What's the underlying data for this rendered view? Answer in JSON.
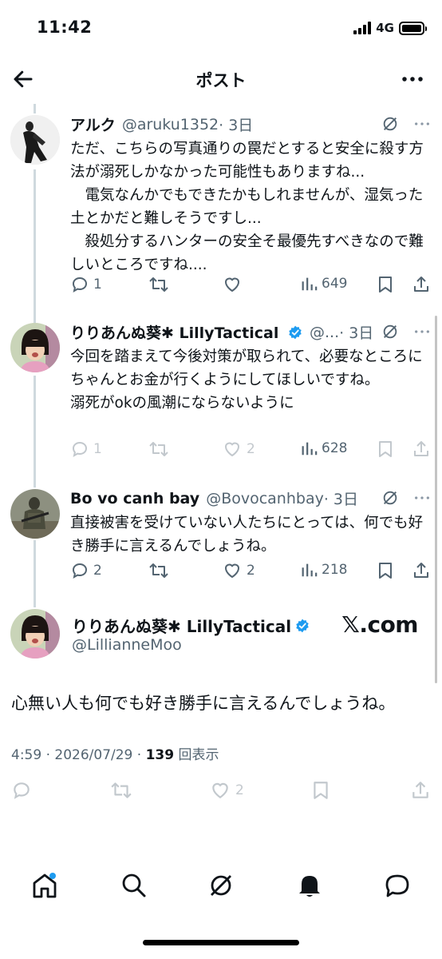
{
  "status_bar": {
    "time": "11:42",
    "network": "4G"
  },
  "header": {
    "title": "ポスト"
  },
  "replies": [
    {
      "name": "アルク",
      "handle": "@aruku1352",
      "time": "· 3日",
      "verified": false,
      "text": "ただ、こちらの写真通りの罠だとすると安全に殺す方法が溺死しかなかった可能性もありますね...\n　電気なんかでもできたかもしれませんが、湿気った土とかだと難しそうですし...\n　殺処分するハンターの安全そ最優先すべきなので難しいところですね....",
      "replies_count": "1",
      "retweets_count": "",
      "likes_count": "",
      "views_count": "649"
    },
    {
      "name": "りりあんぬ葵✱ LillyTactical",
      "handle": "@...",
      "time": "· 3日",
      "verified": true,
      "text": "今回を踏まえて今後対策が取られて、必要なところにちゃんとお金が行くようにしてほしいですね。\n溺死がokの風潮にならないように",
      "replies_count": "1",
      "retweets_count": "",
      "likes_count": "2",
      "views_count": "628"
    },
    {
      "name": "Bo vo canh bay",
      "handle": "@Bovocanhbay",
      "time": "· 3日",
      "verified": false,
      "text": "直接被害を受けていない人たちにとっては、何でも好き勝手に言えるんでしょうね。",
      "replies_count": "2",
      "retweets_count": "",
      "likes_count": "2",
      "views_count": "218"
    }
  ],
  "main_post": {
    "name": "りりあんぬ葵✱ LillyTactical",
    "handle": "@LillianneMoo",
    "watermark": "𝕏.com",
    "text": "心無い人も何でも好き勝手に言えるんでしょうね。",
    "datetime": "4:59 · 2026/07/29 · ",
    "views": "139",
    "views_label": " 回表示",
    "likes_count": "2"
  },
  "colors": {
    "verified_blue": "#1d9bf0",
    "gray": "#536471",
    "line": "#cfd9de"
  }
}
